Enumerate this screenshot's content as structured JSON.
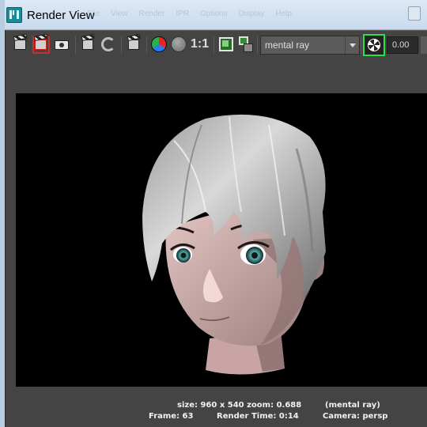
{
  "window": {
    "title": "Render View",
    "ghost_menu": [
      "File",
      "View",
      "Render",
      "IPR",
      "Options",
      "Display",
      "Help"
    ]
  },
  "toolbar": {
    "renderer": "mental ray",
    "exposure": "0.00",
    "scale_label": "1:1",
    "icons": [
      "redo-previous-render-icon",
      "render-region-icon",
      "snapshot-icon",
      "ipr-render-icon",
      "refresh-ipr-icon",
      "render-sequence-icon",
      "display-rgb-icon",
      "display-alpha-icon",
      "real-size-icon",
      "keep-image-icon",
      "remove-image-icon",
      "color-management-icon"
    ]
  },
  "status": {
    "size_line": "size: 960 x 540 zoom: 0.688",
    "renderer_line": "(mental ray)",
    "frame_line": "Frame: 63",
    "render_time_line": "Render Time: 0:14",
    "camera_line": "Camera: persp"
  },
  "colors": {
    "panel_bg": "#444444",
    "viewport_bg": "#000000",
    "titlebar_bg": "#dce8f5",
    "highlight_green": "#27e24a",
    "region_red": "#c9302c",
    "hair": "#b9b9b9",
    "skin": "#d2aeac",
    "eye": "#5fa79b"
  }
}
